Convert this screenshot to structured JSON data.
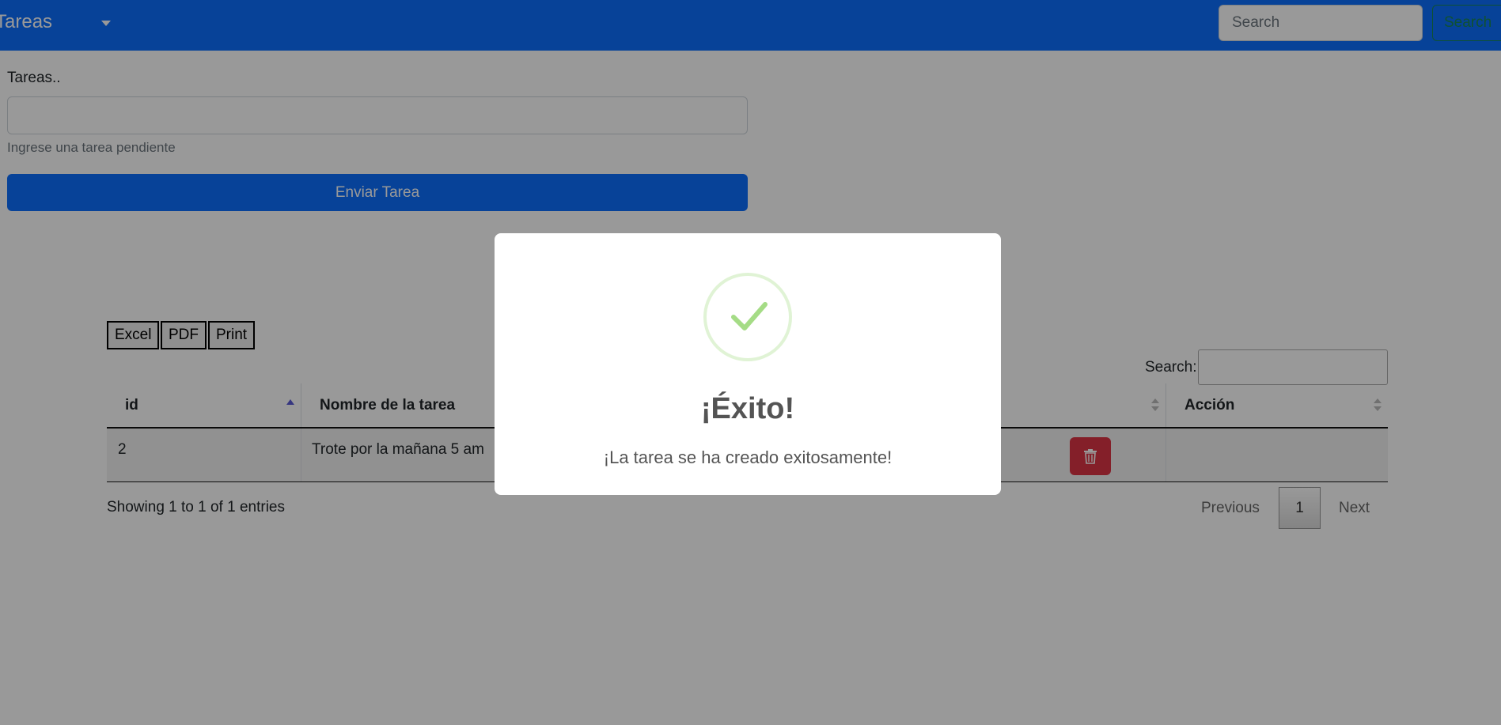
{
  "navbar": {
    "brand": "Tareas",
    "search_placeholder": "Search",
    "search_button": "Search"
  },
  "form": {
    "label": "Tareas..",
    "input_value": "",
    "help_text": "Ingrese una tarea pendiente",
    "submit_label": "Enviar Tarea"
  },
  "export": {
    "excel": "Excel",
    "pdf": "PDF",
    "print": "Print"
  },
  "table": {
    "search_label": "Search:",
    "columns": [
      "id",
      "Nombre de la tarea",
      "Acción"
    ],
    "rows": [
      {
        "id": "2",
        "name": "Trote por la mañana 5 am"
      }
    ],
    "info": "Showing 1 to 1 of 1 entries",
    "pagination": {
      "previous": "Previous",
      "current_page": "1",
      "next": "Next"
    }
  },
  "modal": {
    "icon": "success-check-icon",
    "title": "¡Éxito!",
    "text": "¡La tarea se ha creado exitosamente!"
  },
  "colors": {
    "primary": "#0d6efd",
    "danger": "#dc3545",
    "success_icon": "#a5dc86"
  }
}
